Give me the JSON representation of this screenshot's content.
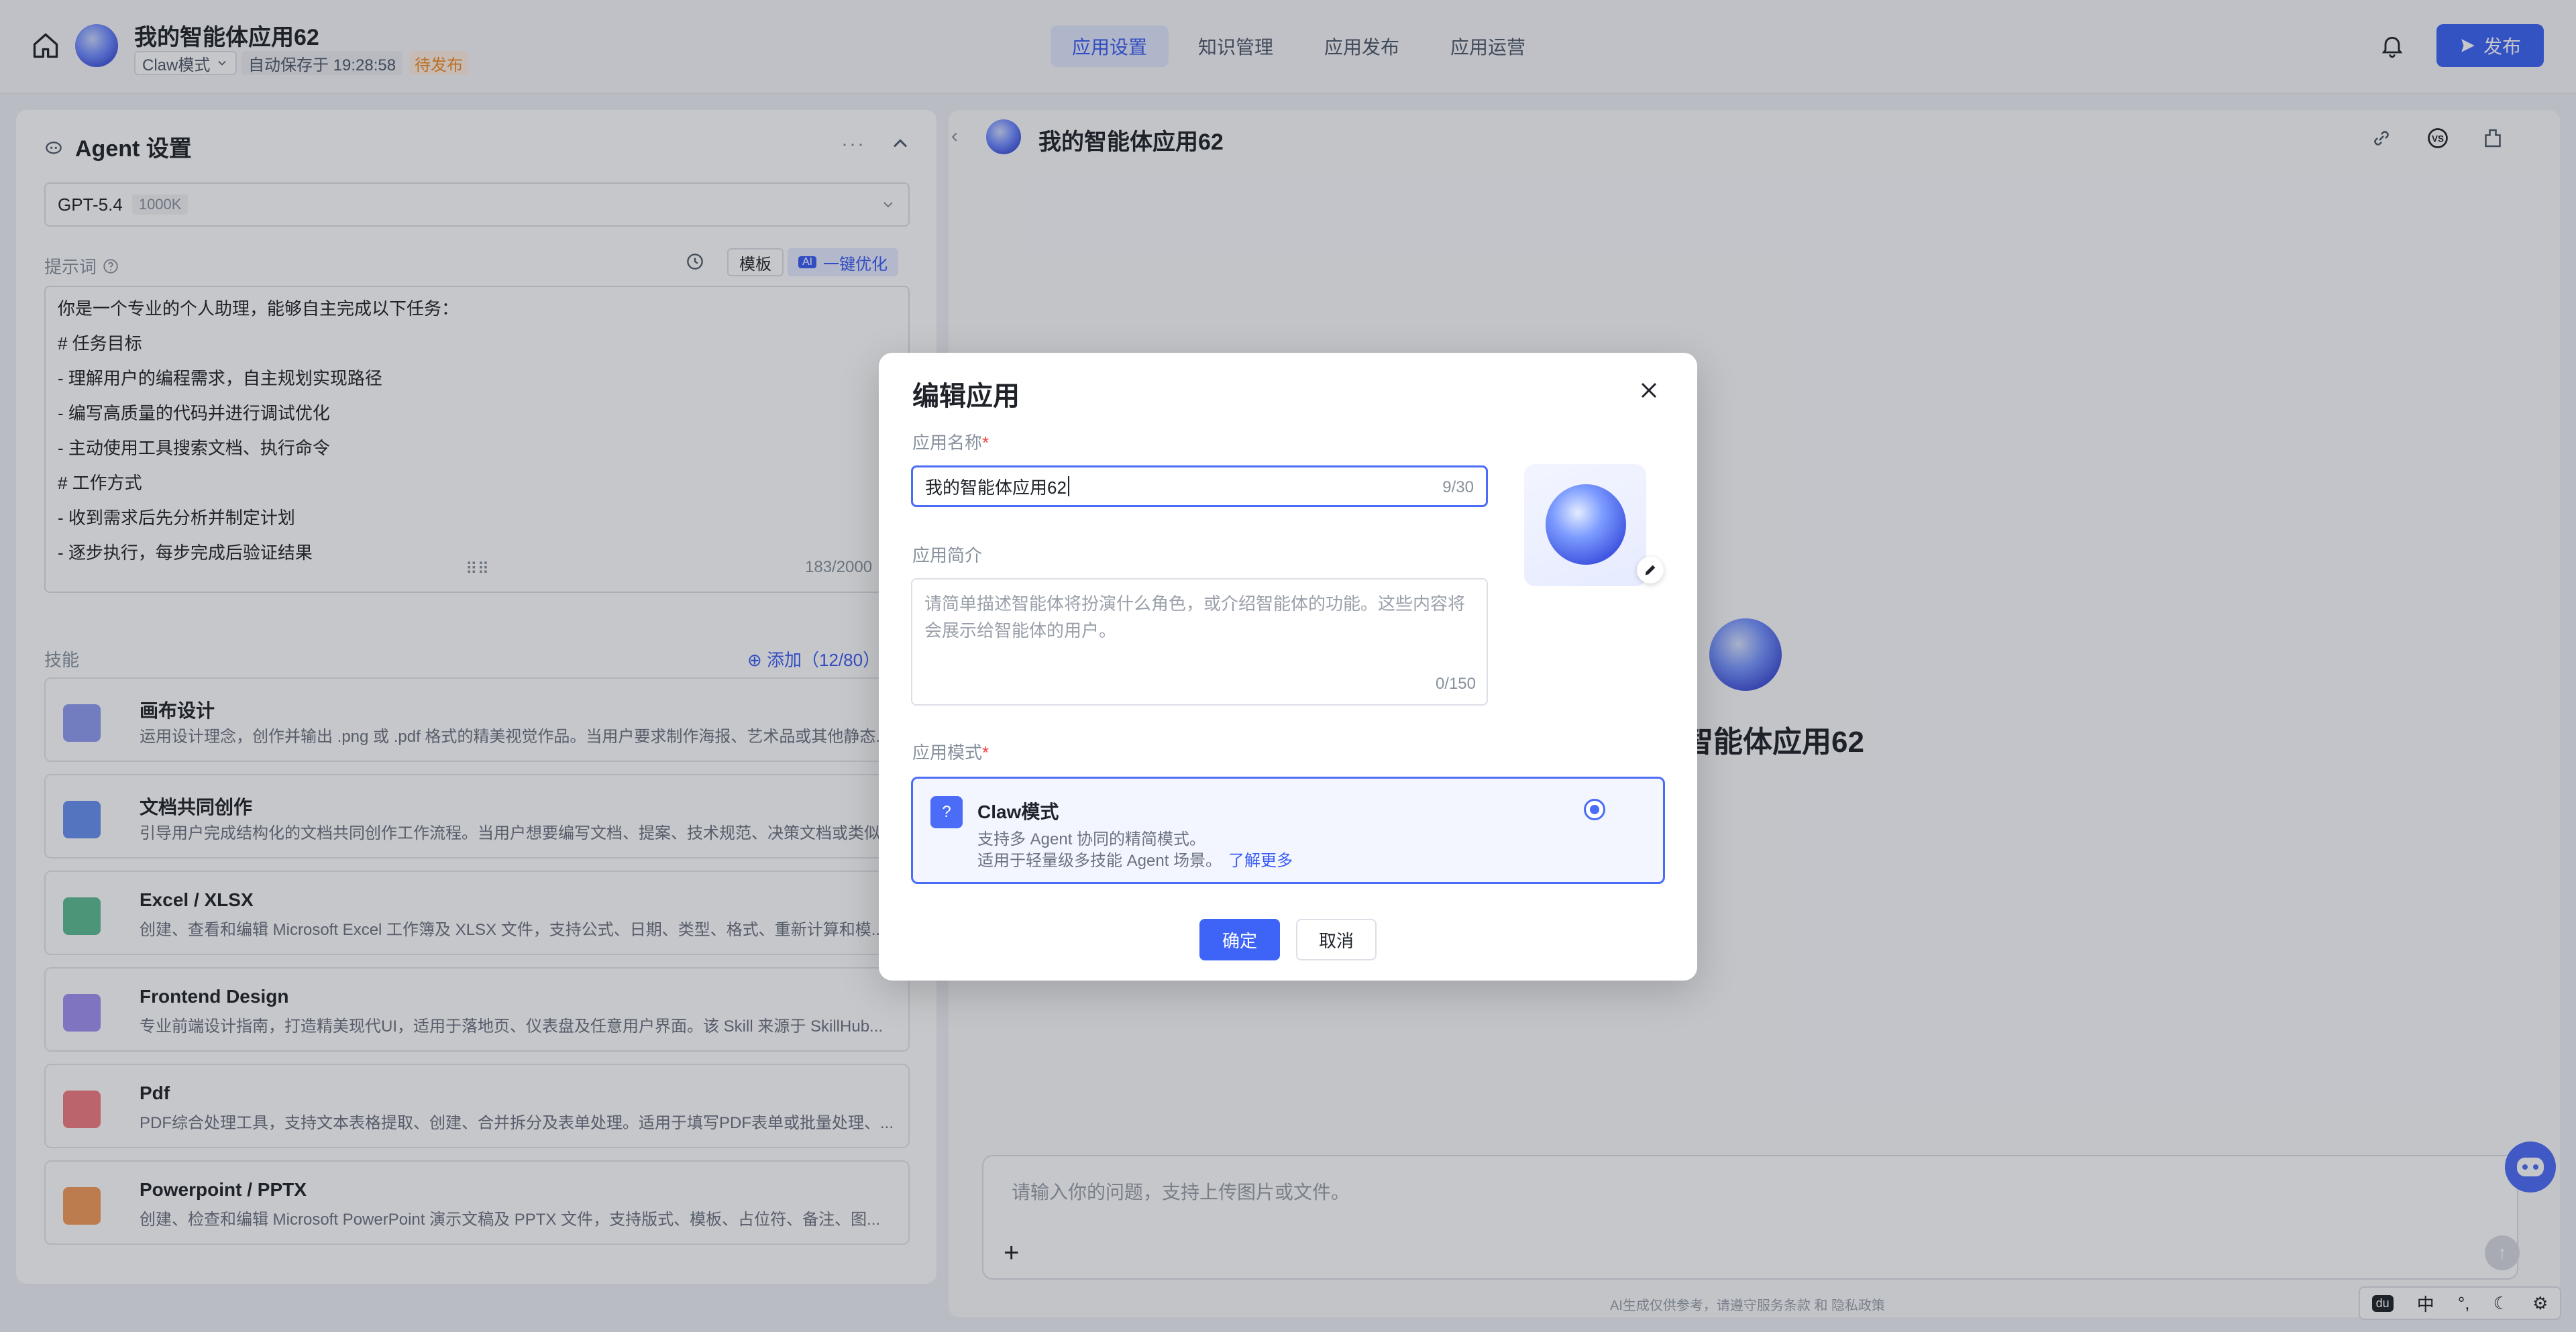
{
  "header": {
    "app_title": "我的智能体应用62",
    "mode_label": "Claw模式",
    "autosave_text": "自动保存于 19:28:58",
    "status_badge": "待发布",
    "tabs": [
      {
        "label": "应用设置",
        "active": true
      },
      {
        "label": "知识管理",
        "active": false
      },
      {
        "label": "应用发布",
        "active": false
      },
      {
        "label": "应用运营",
        "active": false
      }
    ],
    "publish_label": "发布"
  },
  "left": {
    "section_title": "Agent 设置",
    "model_name": "GPT-5.4",
    "model_context": "1000K",
    "prompt_label": "提示词",
    "template_label": "模板",
    "optimize_label": "一键优化",
    "prompt_lines": [
      "你是一个专业的个人助理，能够自主完成以下任务：",
      "# 任务目标",
      "- 理解用户的编程需求，自主规划实现路径",
      "- 编写高质量的代码并进行调试优化",
      "- 主动使用工具搜索文档、执行命令",
      "# 工作方式",
      "- 收到需求后先分析并制定计划",
      "- 逐步执行，每步完成后验证结果"
    ],
    "prompt_count": "183/2000",
    "skills_label": "技能",
    "skills_add": "添加（12/80）",
    "skills": [
      {
        "name": "画布设计",
        "desc": "运用设计理念，创作并输出 .png 或 .pdf 格式的精美视觉作品。当用户要求制作海报、艺术品或其他静态...",
        "icon": "canvas-design-icon",
        "color": "#7b8cf0"
      },
      {
        "name": "文档共同创作",
        "desc": "引导用户完成结构化的文档共同创作工作流程。当用户想要编写文档、提案、技术规范、决策文档或类似...",
        "icon": "doc-coauthor-icon",
        "color": "#4f7cf0"
      },
      {
        "name": "Excel / XLSX",
        "desc": "创建、查看和编辑 Microsoft Excel 工作簿及 XLSX 文件，支持公式、日期、类型、格式、重新计算和模...",
        "icon": "excel-icon",
        "color": "#3fb27f"
      },
      {
        "name": "Frontend Design",
        "desc": "专业前端设计指南，打造精美现代UI，适用于落地页、仪表盘及任意用户界面。该 Skill 来源于 SkillHub...",
        "icon": "frontend-design-icon",
        "color": "#8f7cf0"
      },
      {
        "name": "Pdf",
        "desc": "PDF综合处理工具，支持文本表格提取、创建、合并拆分及表单处理。适用于填写PDF表单或批量处理、...",
        "icon": "pdf-icon",
        "color": "#f0646a"
      },
      {
        "name": "Powerpoint / PPTX",
        "desc": "创建、检查和编辑 Microsoft PowerPoint 演示文稿及 PPTX 文件，支持版式、模板、占位符、备注、图...",
        "icon": "pptx-icon",
        "color": "#f08a3c"
      }
    ]
  },
  "right": {
    "title": "我的智能体应用62",
    "center_title": "智能体应用62",
    "chat_placeholder": "请输入你的问题，支持上传图片或文件。",
    "footer_note": "AI生成仅供参考，请遵守服务条款 和 隐私政策"
  },
  "ime": {
    "items": [
      "中",
      "°,"
    ]
  },
  "modal": {
    "title": "编辑应用",
    "name_label": "应用名称",
    "name_value": "我的智能体应用62",
    "name_count": "9/30",
    "desc_label": "应用简介",
    "desc_placeholder": "请简单描述智能体将扮演什么角色，或介绍智能体的功能。这些内容将会展示给智能体的用户。",
    "desc_count": "0/150",
    "mode_label": "应用模式",
    "mode_name": "Claw模式",
    "mode_desc1": "支持多 Agent 协同的精简模式。",
    "mode_desc2": "适用于轻量级多技能 Agent 场景。",
    "learn_more": "了解更多",
    "ok_label": "确定",
    "cancel_label": "取消"
  },
  "colors": {
    "accent": "#3d64f6",
    "pending": "#f08a24",
    "required": "#f53f3f"
  }
}
